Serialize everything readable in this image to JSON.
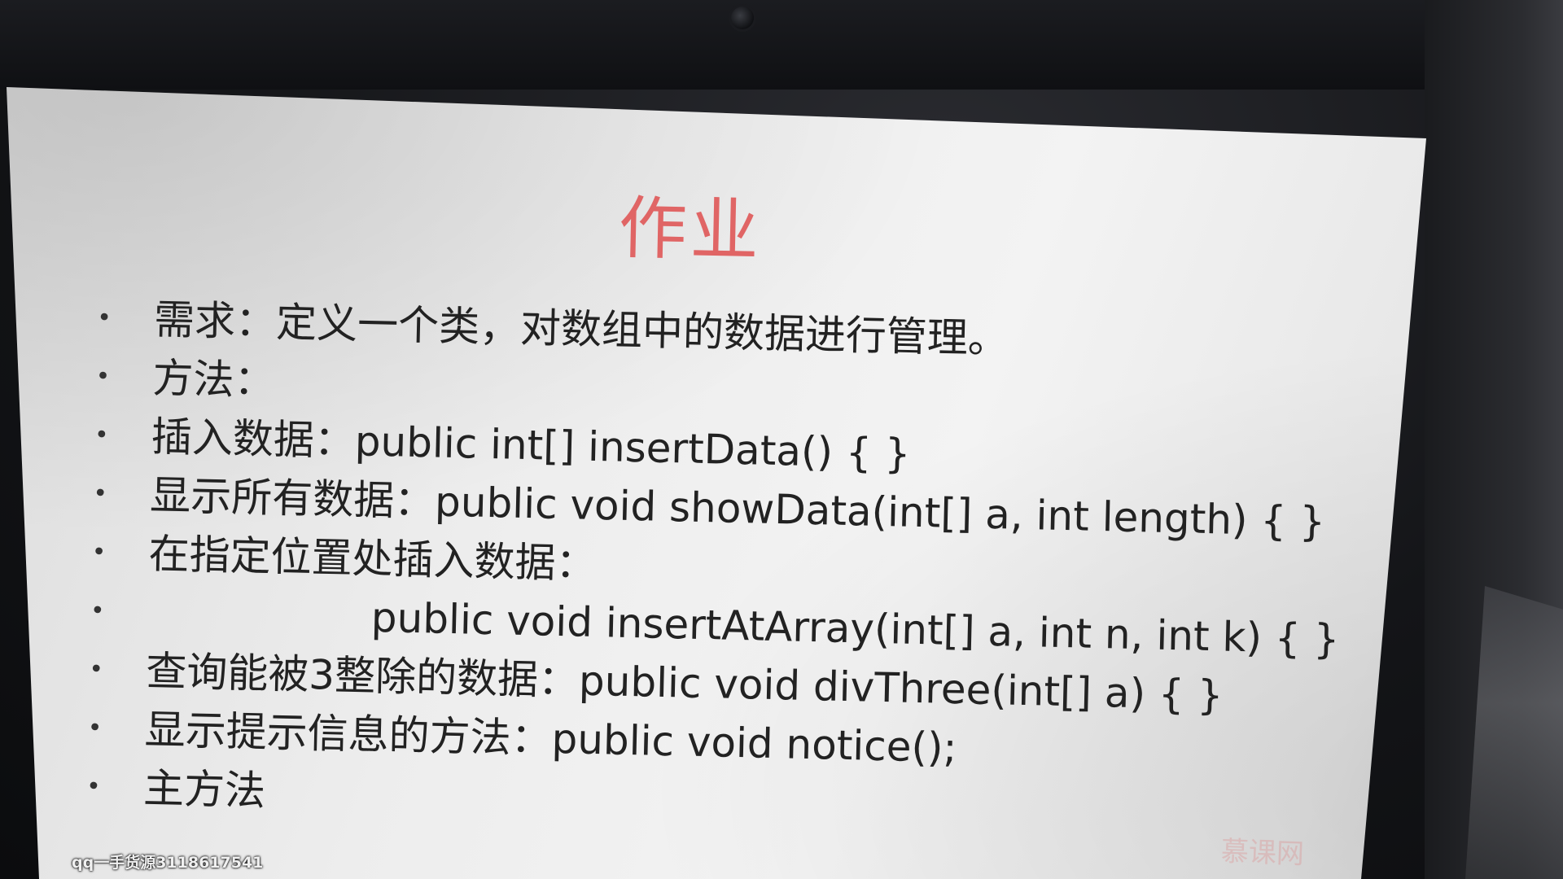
{
  "slide": {
    "title": "作业",
    "title_color": "#e06565",
    "bullets": [
      {
        "marker": "•",
        "text": "需求：定义一个类，对数组中的数据进行管理。"
      },
      {
        "marker": "•",
        "text": "方法："
      },
      {
        "marker": "•",
        "text": "插入数据：public int[] insertData() { }"
      },
      {
        "marker": "•",
        "text": "显示所有数据：public void showData(int[] a, int length) { }"
      },
      {
        "marker": "•",
        "text": "在指定位置处插入数据："
      },
      {
        "marker": "•",
        "text": "public void insertAtArray(int[] a, int n, int k) { }"
      },
      {
        "marker": "•",
        "text": "查询能被3整除的数据：public void divThree(int[] a) { }"
      },
      {
        "marker": "•",
        "text": "显示提示信息的方法：public void notice();"
      },
      {
        "marker": "•",
        "text": "主方法"
      }
    ],
    "logo_text": "慕课网"
  },
  "overlay": {
    "watermark": "qq一手货源3118617541"
  }
}
